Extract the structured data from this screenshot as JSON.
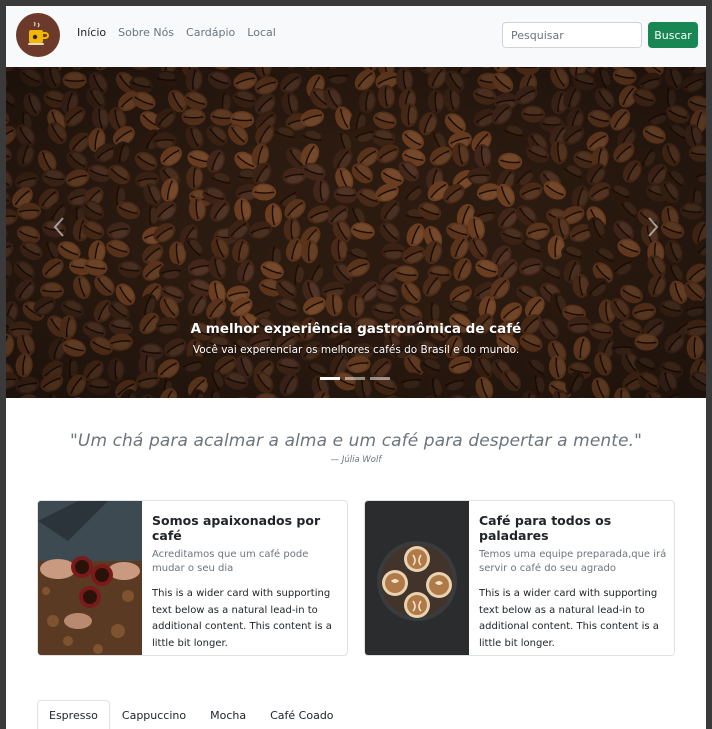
{
  "navbar": {
    "links": [
      {
        "label": "Início",
        "active": true
      },
      {
        "label": "Sobre Nós",
        "active": false
      },
      {
        "label": "Cardápio",
        "active": false
      },
      {
        "label": "Local",
        "active": false
      }
    ],
    "search_placeholder": "Pesquisar",
    "search_button": "Buscar"
  },
  "carousel": {
    "caption_title": "A melhor experiência gastronômica de café",
    "caption_text": "Você vai experenciar os melhores cafés do Brasil e do mundo.",
    "prev_icon": "chevron-left-icon",
    "next_icon": "chevron-right-icon",
    "slide_count": 3,
    "active_slide": 1
  },
  "quote": {
    "text": "\"Um chá para acalmar a alma e um café para despertar a mente.\"",
    "author_dash": "—",
    "author": "Júlia Wolf"
  },
  "cards": [
    {
      "title": "Somos apaixonados por café",
      "subtitle": "Acreditamos que um café pode mudar o seu dia",
      "text": "This is a wider card with supporting text below as a natural lead-in to additional content. This content is a little bit longer."
    },
    {
      "title": "Café para todos os paladares",
      "subtitle": "Temos uma equipe preparada,que irá servir o café do seu agrado",
      "text": "This is a wider card with supporting text below as a natural lead-in to additional content. This content is a little bit longer."
    }
  ],
  "tabs": [
    {
      "label": "Espresso",
      "active": true
    },
    {
      "label": "Cappuccino",
      "active": false
    },
    {
      "label": "Mocha",
      "active": false
    },
    {
      "label": "Café Coado",
      "active": false
    }
  ],
  "colors": {
    "brand_green": "#198754",
    "logo_brown": "#6b3a2a",
    "navbar_bg": "#f8f9fa",
    "muted_text": "#6c757d"
  }
}
